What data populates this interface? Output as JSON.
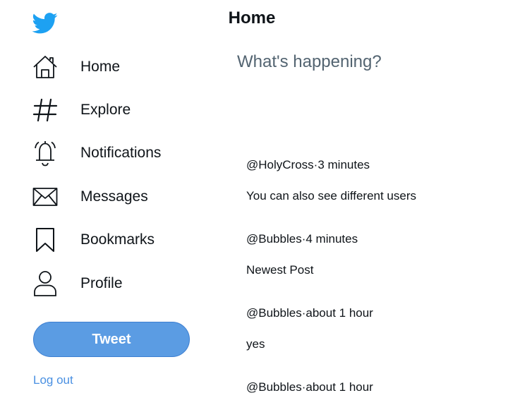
{
  "header": {
    "title": "Home"
  },
  "sidebar": {
    "logo_icon": "twitter-bird-icon",
    "items": [
      {
        "label": "Home",
        "icon": "home-icon"
      },
      {
        "label": "Explore",
        "icon": "hashtag-icon"
      },
      {
        "label": "Notifications",
        "icon": "bell-icon"
      },
      {
        "label": "Messages",
        "icon": "envelope-icon"
      },
      {
        "label": "Bookmarks",
        "icon": "bookmark-icon"
      },
      {
        "label": "Profile",
        "icon": "person-icon"
      }
    ],
    "tweet_label": "Tweet",
    "logout_label": "Log out"
  },
  "compose": {
    "placeholder": "What's happening?"
  },
  "posts": [
    {
      "handle": "@HolyCross",
      "separator": "·",
      "time": "3 minutes",
      "text": "You can also see different users"
    },
    {
      "handle": "@Bubbles",
      "separator": "·",
      "time": "4 minutes",
      "text": "Newest Post"
    },
    {
      "handle": "@Bubbles",
      "separator": "·",
      "time": "about 1 hour",
      "text": "yes"
    },
    {
      "handle": "@Bubbles",
      "separator": "·",
      "time": "about 1 hour",
      "text": ""
    }
  ],
  "colors": {
    "brand": "#1da1f2",
    "tweet_button": "#5b9ce3",
    "link": "#4a90e2",
    "placeholder": "#536471",
    "text": "#0f1419"
  }
}
